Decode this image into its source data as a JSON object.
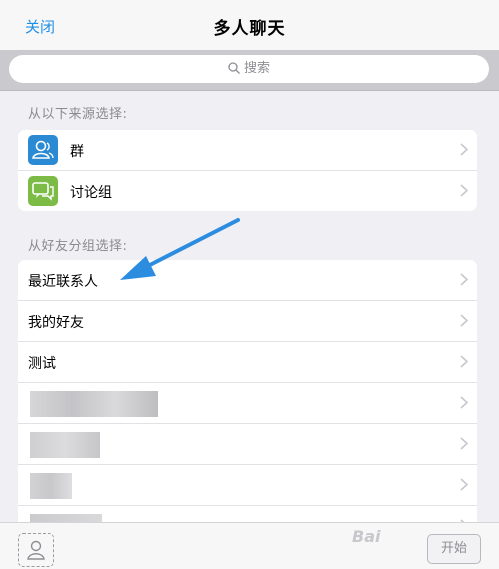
{
  "nav": {
    "close_label": "关闭",
    "title": "多人聊天"
  },
  "search": {
    "placeholder": "搜索"
  },
  "sources": {
    "label": "从以下来源选择:",
    "items": [
      {
        "label": "群",
        "icon": "group-icon",
        "color": "#2a8ad4"
      },
      {
        "label": "讨论组",
        "icon": "discussion-icon",
        "color": "#7cbb45"
      }
    ]
  },
  "friends": {
    "label": "从好友分组选择:",
    "items": [
      {
        "label": "最近联系人"
      },
      {
        "label": "我的好友"
      },
      {
        "label": "测试"
      }
    ]
  },
  "bottom": {
    "start_label": "开始"
  },
  "watermark": {
    "text": "Bai"
  },
  "colors": {
    "accent": "#1f8fe6",
    "annotation_arrow": "#2c8ce0"
  }
}
